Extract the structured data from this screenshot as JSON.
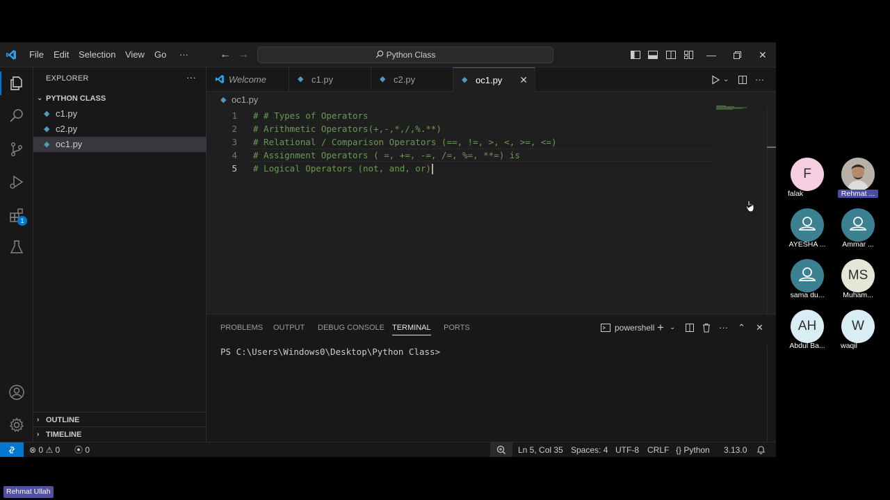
{
  "titlebar": {
    "menus": [
      "File",
      "Edit",
      "Selection",
      "View",
      "Go"
    ],
    "more": "···",
    "command_center": "Python Class",
    "icons": [
      "vscode-logo-icon",
      "back-arrow-icon",
      "forward-arrow-icon",
      "search-icon",
      "toggle-sidebar-icon",
      "toggle-panel-icon",
      "toggle-secondary-sidebar-icon",
      "customize-layout-icon",
      "minimize-icon",
      "restore-icon",
      "close-icon"
    ]
  },
  "activitybar": {
    "items": [
      "explorer-icon",
      "search-icon",
      "source-control-icon",
      "run-debug-icon",
      "extensions-icon",
      "testing-icon"
    ],
    "extensions_badge": "1",
    "bottom": [
      "accounts-icon",
      "manage-gear-icon"
    ]
  },
  "sidebar": {
    "title": "EXPLORER",
    "more": "···",
    "folder": "PYTHON CLASS",
    "files": [
      "c1.py",
      "c2.py",
      "oc1.py"
    ],
    "selected_file": "oc1.py",
    "outline": "OUTLINE",
    "timeline": "TIMELINE"
  },
  "tabs": {
    "items": [
      {
        "label": "Welcome",
        "icon": "vscode-icon"
      },
      {
        "label": "c1.py",
        "icon": "python-icon"
      },
      {
        "label": "c2.py",
        "icon": "python-icon"
      },
      {
        "label": "oc1.py",
        "icon": "python-icon"
      }
    ],
    "active": "oc1.py",
    "close": "✕"
  },
  "breadcrumb": "oc1.py",
  "editor": {
    "lines": [
      "# # Types of Operators",
      "# Arithmetic Operators(+,-,*,/,%.**)",
      "# Relational / Comparison Operators (==, !=, >, <, >=, <=)",
      "# Assignment Operators ( =, +=, -=, /=, %=, **=) is",
      "# Logical Operators (not, and, or)"
    ],
    "line_numbers": [
      "1",
      "2",
      "3",
      "4",
      "5"
    ],
    "current_line": 5,
    "comment_color": "#6a9955"
  },
  "panel": {
    "tabs": [
      "PROBLEMS",
      "OUTPUT",
      "DEBUG CONSOLE",
      "TERMINAL",
      "PORTS"
    ],
    "active_tab": "TERMINAL",
    "terminal_name": "powershell",
    "prompt": "PS C:\\Users\\Windows0\\Desktop\\Python Class>"
  },
  "statusbar": {
    "errors": "0",
    "warnings": "0",
    "ports": "0",
    "position": "Ln 5, Col 35",
    "spaces": "Spaces: 4",
    "encoding": "UTF-8",
    "eol": "CRLF",
    "language": "Python",
    "interpreter": "3.13.0",
    "accent": "#0078d4"
  },
  "meeting": {
    "participants": [
      {
        "name": "falak",
        "initials": "F"
      },
      {
        "name": "Rehmat ...",
        "initials": ""
      },
      {
        "name": "AYESHA ...",
        "initials": ""
      },
      {
        "name": "Ammar ...",
        "initials": ""
      },
      {
        "name": "sama du...",
        "initials": ""
      },
      {
        "name": "Muham...",
        "initials": "MS"
      },
      {
        "name": "Abdul Ba...",
        "initials": "AH"
      },
      {
        "name": "waqil",
        "initials": "W"
      }
    ],
    "self_label": "Rehmat Ullah"
  }
}
